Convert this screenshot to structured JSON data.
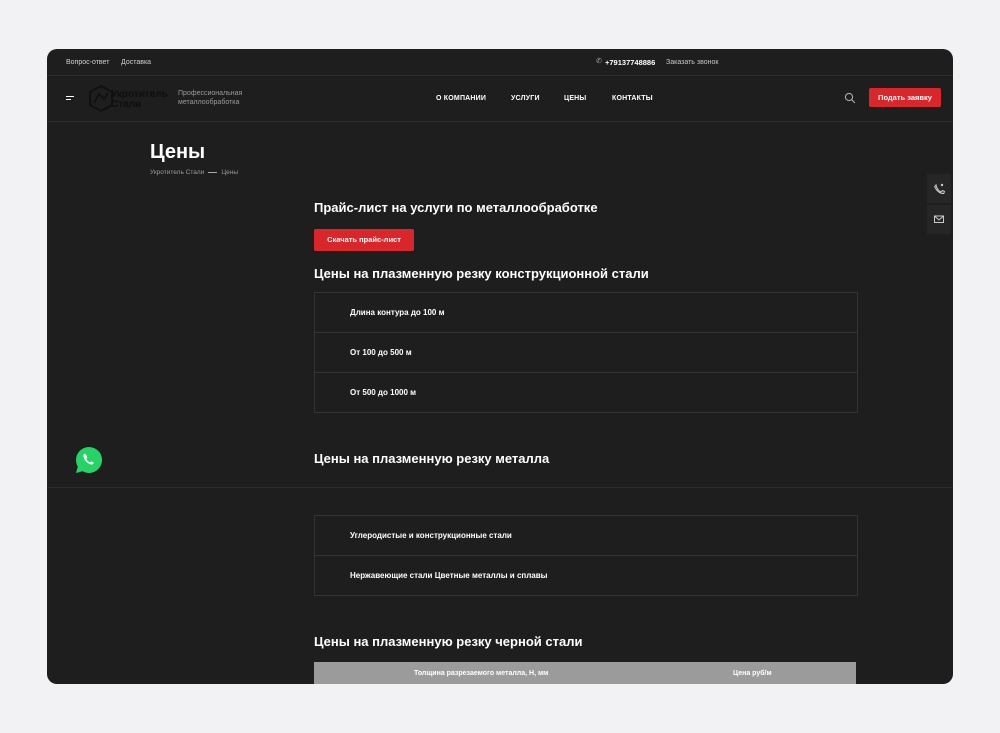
{
  "topbar": {
    "links": [
      "Вопрос-ответ",
      "Доставка"
    ],
    "phone": "+79137748886",
    "callback": "Заказать звонок"
  },
  "header": {
    "logo_line1": "Укротитель",
    "logo_line2": "Стали",
    "tagline": "Профессиональная металлообработка",
    "nav": [
      "О КОМПАНИИ",
      "УСЛУГИ",
      "ЦЕНЫ",
      "КОНТАКТЫ"
    ],
    "cta": "Подать заявку"
  },
  "page": {
    "title": "Цены",
    "breadcrumb": [
      "Укротитель Стали",
      "Цены"
    ]
  },
  "sections": {
    "pricelist_title": "Прайс-лист на услуги по металлообработке",
    "download_label": "Скачать прайс-лист",
    "construction_title": "Цены на плазменную резку конструкционной стали",
    "construction_rows": [
      "Длина контура до 100 м",
      "От 100 до 500 м",
      "От 500 до 1000 м"
    ],
    "metal_title": "Цены на плазменную резку металла",
    "metal_rows": [
      "Углеродистые и конструкционные стали",
      "Нержавеющие стали Цветные металлы и сплавы"
    ],
    "black_title": "Цены на плазменную резку черной стали",
    "table_headers": [
      "Толщина разрезаемого металла, Н, мм",
      "Цена руб/м"
    ]
  },
  "colors": {
    "accent": "#d9262b",
    "background": "#1e1e1e",
    "whatsapp": "#25d366"
  }
}
